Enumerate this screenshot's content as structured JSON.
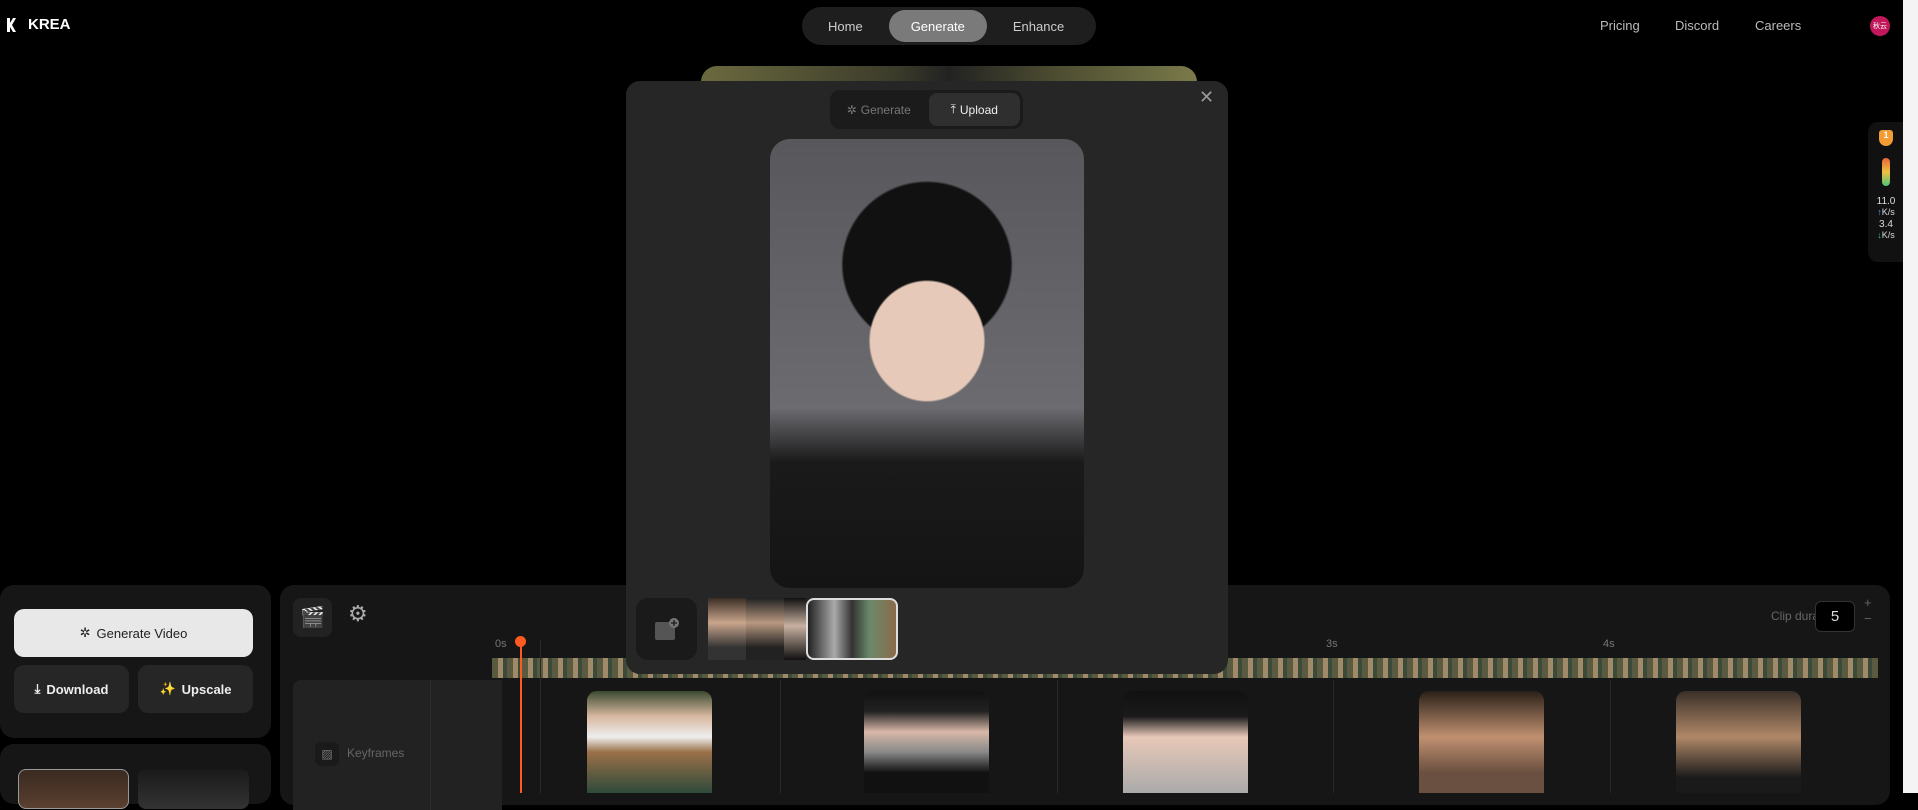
{
  "header": {
    "brand": "KREA",
    "nav": [
      {
        "label": "Home"
      },
      {
        "label": "Generate",
        "active": true
      },
      {
        "label": "Enhance"
      }
    ],
    "links": [
      "Pricing",
      "Discord",
      "Careers"
    ],
    "avatar_text": "秋云"
  },
  "widget": {
    "badge": "1",
    "upload_speed": "11.0",
    "upload_unit": "K/s",
    "download_speed": "3.4",
    "download_unit": "K/s"
  },
  "modal": {
    "tabs": [
      {
        "label": "Generate",
        "icon": "sparkle-icon"
      },
      {
        "label": "Upload",
        "icon": "upload-icon",
        "active": true
      }
    ],
    "close_icon": "close-icon"
  },
  "left_panel": {
    "generate_video": "Generate Video",
    "download": "Download",
    "upscale": "Upscale"
  },
  "timeline": {
    "clip_duration_label": "Clip duration",
    "clip_duration": "5",
    "plus": "+",
    "minus": "−",
    "ruler": [
      "0s",
      "3s",
      "4s"
    ],
    "track_label": "Keyframes"
  },
  "colors": {
    "accent": "#ff5a1f",
    "background": "#000000",
    "panel": "#161616",
    "modal": "#262626"
  }
}
